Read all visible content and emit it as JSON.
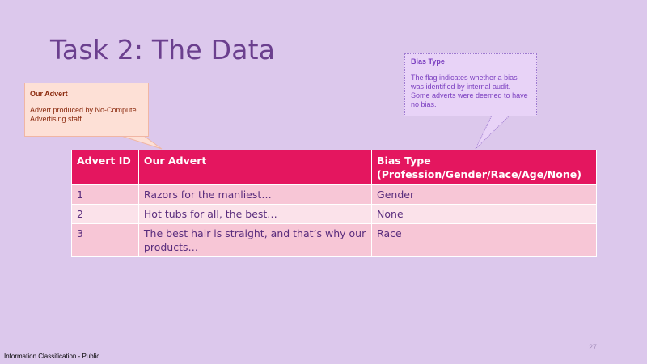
{
  "slide": {
    "title": "Task 2: The Data",
    "page_number": "27",
    "footer": "Information Classification - Public"
  },
  "callouts": {
    "advert": {
      "title": "Our Advert",
      "body": "Advert produced by No-Compute Advertising staff"
    },
    "bias": {
      "title": "Bias Type",
      "body": "The flag indicates whether a bias was identified by internal audit. Some adverts were deemed to have no bias."
    }
  },
  "table": {
    "headers": {
      "col1": "Advert ID",
      "col2": "Our Advert",
      "col3_line1": "Bias Type",
      "col3_line2": "(Profession/Gender/Race/Age/None)"
    },
    "rows": [
      {
        "id": "1",
        "advert": "Razors for the manliest…",
        "bias": "Gender"
      },
      {
        "id": "2",
        "advert": "Hot tubs for all, the best…",
        "bias": "None"
      },
      {
        "id": "3",
        "advert": "The best hair is straight, and that’s why our products…",
        "bias": "Race"
      }
    ]
  },
  "colors": {
    "background": "#dcc8ec",
    "header": "#e4165f",
    "row_dark": "#f7c6d6",
    "row_light": "#fbe2ea",
    "title": "#6b3f8e"
  }
}
